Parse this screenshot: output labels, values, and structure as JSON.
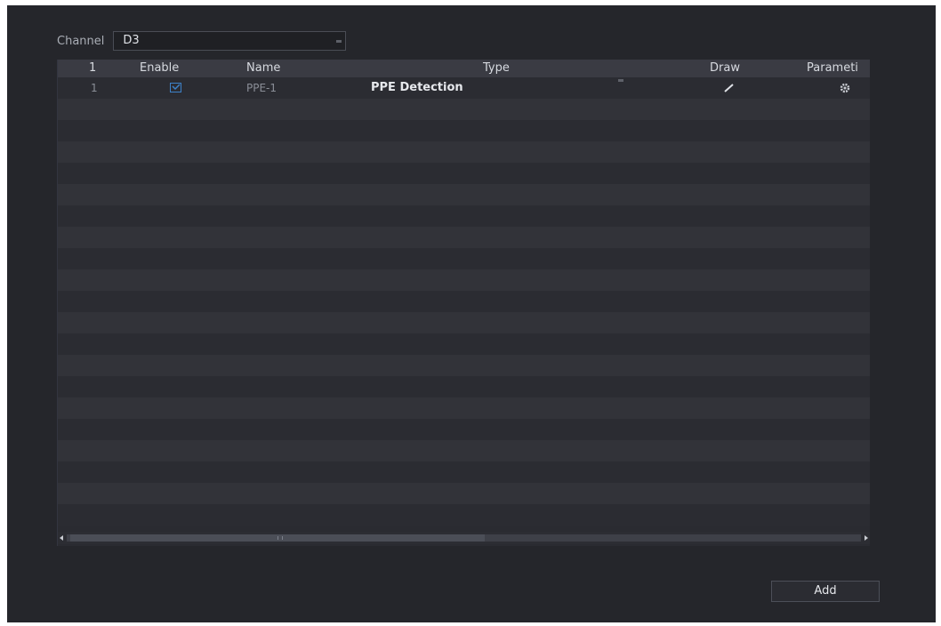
{
  "channel": {
    "label": "Channel",
    "value": "D3"
  },
  "table": {
    "columns": [
      "1",
      "Enable",
      "Name",
      "Type",
      "Draw",
      "Parameti"
    ],
    "rows": [
      {
        "index": "1",
        "enabled": true,
        "name": "PPE-1",
        "type": "PPE Detection",
        "draw_icon": "pencil-icon",
        "parameter_icon": "gear-icon"
      }
    ]
  },
  "buttons": {
    "add_label": "Add"
  },
  "colors": {
    "panel_bg": "#25262b",
    "accent": "#3d82c9"
  }
}
